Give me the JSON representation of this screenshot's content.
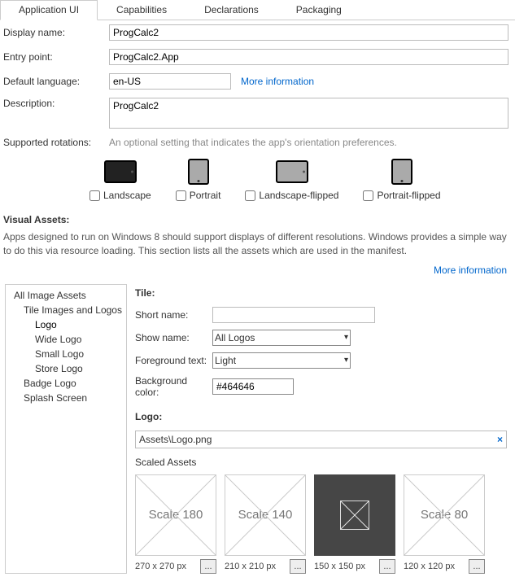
{
  "tabs": {
    "application_ui": "Application UI",
    "capabilities": "Capabilities",
    "declarations": "Declarations",
    "packaging": "Packaging"
  },
  "form": {
    "display_name_label": "Display name:",
    "display_name_value": "ProgCalc2",
    "entry_point_label": "Entry point:",
    "entry_point_value": "ProgCalc2.App",
    "default_language_label": "Default language:",
    "default_language_value": "en-US",
    "more_information": "More information",
    "description_label": "Description:",
    "description_value": "ProgCalc2",
    "supported_rotations_label": "Supported rotations:",
    "supported_rotations_hint": "An optional setting that indicates the app's orientation preferences."
  },
  "rotations": {
    "landscape": "Landscape",
    "portrait": "Portrait",
    "landscape_flipped": "Landscape-flipped",
    "portrait_flipped": "Portrait-flipped"
  },
  "visual_assets": {
    "heading": "Visual Assets:",
    "description": "Apps designed to run on Windows 8 should support displays of different resolutions. Windows provides a simple way to do this via resource loading. This section lists all the assets which are used in the manifest.",
    "more_information": "More information"
  },
  "tree": {
    "all_image_assets": "All Image Assets",
    "tile_images_and_logos": "Tile Images and Logos",
    "logo": "Logo",
    "wide_logo": "Wide Logo",
    "small_logo": "Small Logo",
    "store_logo": "Store Logo",
    "badge_logo": "Badge Logo",
    "splash_screen": "Splash Screen"
  },
  "tile": {
    "heading": "Tile:",
    "short_name_label": "Short name:",
    "short_name_value": "",
    "show_name_label": "Show name:",
    "show_name_value": "All Logos",
    "foreground_text_label": "Foreground text:",
    "foreground_text_value": "Light",
    "background_color_label": "Background color:",
    "background_color_value": "#464646"
  },
  "logo": {
    "heading": "Logo:",
    "path": "Assets\\Logo.png",
    "clear": "×",
    "scaled_assets_label": "Scaled Assets"
  },
  "scaled": {
    "items": [
      {
        "label": "Scale 180",
        "dim": "270 x 270 px"
      },
      {
        "label": "Scale 140",
        "dim": "210 x 210 px"
      },
      {
        "label": "",
        "dim": "150 x 150 px"
      },
      {
        "label": "Scale 80",
        "dim": "120 x 120 px"
      }
    ],
    "browse": "..."
  }
}
